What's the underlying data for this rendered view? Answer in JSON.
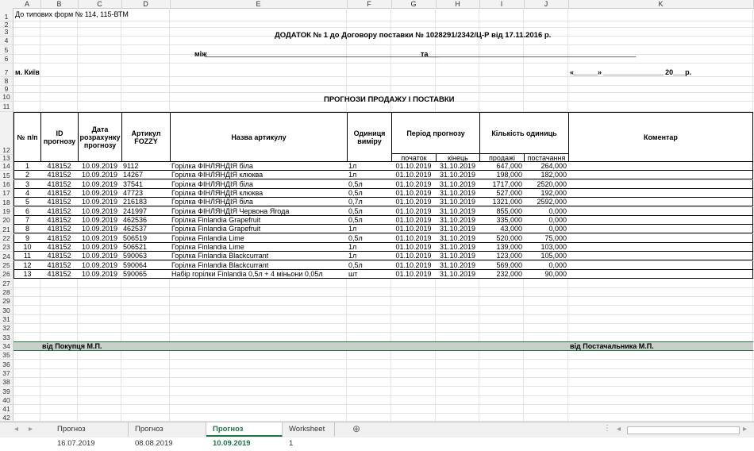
{
  "columns": [
    "A",
    "B",
    "C",
    "D",
    "E",
    "F",
    "G",
    "H",
    "I",
    "J",
    "K"
  ],
  "row_numbers": [
    "1",
    "2",
    "3",
    "4",
    "5",
    "6",
    "7",
    "8",
    "9",
    "10",
    "11",
    "12",
    "13",
    "14",
    "15",
    "16",
    "17",
    "18",
    "19",
    "20",
    "21",
    "22",
    "23",
    "24",
    "25",
    "26",
    "27",
    "28",
    "29",
    "30",
    "31",
    "32",
    "33",
    "34",
    "35",
    "36",
    "37",
    "38",
    "39",
    "40",
    "41",
    "42"
  ],
  "top_note": "До типових форм № 114, 115-ВТМ",
  "title": "ДОДАТОК № 1 до Договору поставки № 1028291/2342/Ц-Р від 17.11.2016 р.",
  "between_label": "між",
  "between_line": "___________________________________________________________",
  "and_label": "та",
  "and_line": "____________________________________________________",
  "city": "м. Київ",
  "date_blank": "«______» _______________ 20___р.",
  "section_title": "ПРОГНОЗИ ПРОДАЖУ І ПОСТАВКИ",
  "headers": {
    "num": "№ п/п",
    "id": "ID прогнозу",
    "calc_date": "Дата розрахунку прогнозу",
    "article": "Артикул FOZZY",
    "name": "Назва артикулу",
    "unit": "Одиниця виміру",
    "period": "Період прогнозу",
    "period_start": "початок",
    "period_end": "кінець",
    "qty": "Кількість одиниць",
    "qty_sales": "продажі",
    "qty_supply": "постачання",
    "comment": "Коментар"
  },
  "rows": [
    {
      "n": "1",
      "id": "418152",
      "date": "10.09.2019",
      "art": "9112",
      "name": "Горілка ФІНЛЯНДІЯ біла",
      "unit": "1л",
      "start": "01.10.2019",
      "end": "31.10.2019",
      "sales": "647,000",
      "supply": "264,000"
    },
    {
      "n": "2",
      "id": "418152",
      "date": "10.09.2019",
      "art": "14267",
      "name": "Горілка ФІНЛЯНДІЯ клюква",
      "unit": "1л",
      "start": "01.10.2019",
      "end": "31.10.2019",
      "sales": "198,000",
      "supply": "182,000"
    },
    {
      "n": "3",
      "id": "418152",
      "date": "10.09.2019",
      "art": "37541",
      "name": "Горілка ФІНЛЯНДІЯ біла",
      "unit": "0,5л",
      "start": "01.10.2019",
      "end": "31.10.2019",
      "sales": "1717,000",
      "supply": "2520,000"
    },
    {
      "n": "4",
      "id": "418152",
      "date": "10.09.2019",
      "art": "47723",
      "name": "Горілка ФІНЛЯНДІЯ клюква",
      "unit": "0,5л",
      "start": "01.10.2019",
      "end": "31.10.2019",
      "sales": "527,000",
      "supply": "192,000"
    },
    {
      "n": "5",
      "id": "418152",
      "date": "10.09.2019",
      "art": "216183",
      "name": "Горілка ФІНЛЯНДІЯ біла",
      "unit": "0,7л",
      "start": "01.10.2019",
      "end": "31.10.2019",
      "sales": "1321,000",
      "supply": "2592,000"
    },
    {
      "n": "6",
      "id": "418152",
      "date": "10.09.2019",
      "art": "241997",
      "name": "Горілка ФІНЛЯНДІЯ Червона Ягода",
      "unit": "0,5л",
      "start": "01.10.2019",
      "end": "31.10.2019",
      "sales": "855,000",
      "supply": "0,000"
    },
    {
      "n": "7",
      "id": "418152",
      "date": "10.09.2019",
      "art": "462536",
      "name": "Горілка Finlandia Grapefruit",
      "unit": "0,5л",
      "start": "01.10.2019",
      "end": "31.10.2019",
      "sales": "335,000",
      "supply": "0,000"
    },
    {
      "n": "8",
      "id": "418152",
      "date": "10.09.2019",
      "art": "462537",
      "name": "Горілка Finlandia Grapefruit",
      "unit": "1л",
      "start": "01.10.2019",
      "end": "31.10.2019",
      "sales": "43,000",
      "supply": "0,000"
    },
    {
      "n": "9",
      "id": "418152",
      "date": "10.09.2019",
      "art": "506519",
      "name": "Горілка Finlandia Lime",
      "unit": "0,5л",
      "start": "01.10.2019",
      "end": "31.10.2019",
      "sales": "520,000",
      "supply": "75,000"
    },
    {
      "n": "10",
      "id": "418152",
      "date": "10.09.2019",
      "art": "506521",
      "name": "Горілка Finlandia Lime",
      "unit": "1л",
      "start": "01.10.2019",
      "end": "31.10.2019",
      "sales": "139,000",
      "supply": "103,000"
    },
    {
      "n": "11",
      "id": "418152",
      "date": "10.09.2019",
      "art": "590063",
      "name": "Горілка Finlandia Blackcurrant",
      "unit": "1л",
      "start": "01.10.2019",
      "end": "31.10.2019",
      "sales": "123,000",
      "supply": "105,000"
    },
    {
      "n": "12",
      "id": "418152",
      "date": "10.09.2019",
      "art": "590064",
      "name": "Горілка Finlandia Blackcurrant",
      "unit": "0,5л",
      "start": "01.10.2019",
      "end": "31.10.2019",
      "sales": "569,000",
      "supply": "0,000"
    },
    {
      "n": "13",
      "id": "418152",
      "date": "10.09.2019",
      "art": "590065",
      "name": "Набір горілки Finlandia 0,5л + 4 міньони 0,05л",
      "unit": "шт",
      "start": "01.10.2019",
      "end": "31.10.2019",
      "sales": "232,000",
      "supply": "90,000"
    }
  ],
  "signature": {
    "buyer": "від Покупця    М.П.",
    "supplier": "від Постачальника    М.П."
  },
  "tabs": [
    "Прогноз 16.07.2019",
    "Прогноз 08.08.2019",
    "Прогноз 10.09.2019",
    "Worksheet 1"
  ],
  "active_tab": "Прогноз 10.09.2019",
  "colors": {
    "active_tab": "#217346",
    "highlight_row": "#c9cfc9"
  }
}
